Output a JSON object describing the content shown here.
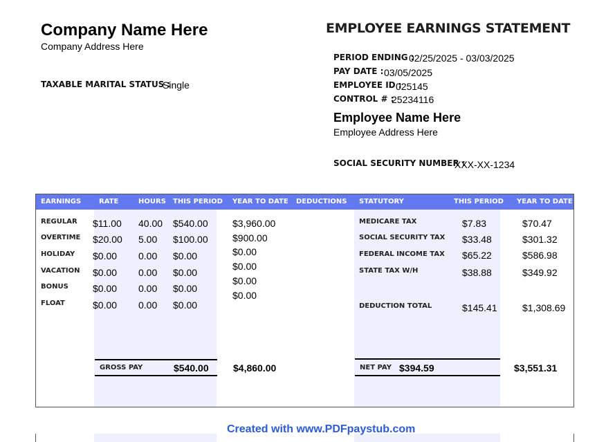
{
  "company": {
    "name": "Company Name Here",
    "address": "Company Address Here"
  },
  "title": "EMPLOYEE EARNINGS STATEMENT",
  "taxable_marital_status": {
    "label": "TAXABLE MARITAL STATUS :",
    "value": "Single"
  },
  "info": {
    "period_ending": {
      "label": "PERIOD ENDING :",
      "value": "02/25/2025 - 03/03/2025"
    },
    "pay_date": {
      "label": "PAY DATE :",
      "value": "03/05/2025"
    },
    "employee_id": {
      "label": "EMPLOYEE ID :",
      "value": "025145"
    },
    "control": {
      "label": "CONTROL # :",
      "value": "25234116"
    }
  },
  "employee": {
    "name": "Employee Name Here",
    "address": "Employee Address Here"
  },
  "ssn": {
    "label": "SOCIAL SECURITY NUMBER :",
    "value": "XXX-XX-1234"
  },
  "table_headers": {
    "earnings": "EARNINGS",
    "rate": "RATE",
    "hours": "HOURS",
    "this_period": "THIS PERIOD",
    "year_to_date": "YEAR TO DATE",
    "deductions": "DEDUCTIONS",
    "statutory": "STATUTORY",
    "this_period_2": "THIS PERIOD",
    "year_to_date_2": "YEAR TO DATE"
  },
  "earnings": [
    {
      "label": "REGULAR",
      "rate": "$11.00",
      "hours": "40.00",
      "this_period": "$540.00",
      "ytd": "$3,960.00"
    },
    {
      "label": "OVERTIME",
      "rate": "$20.00",
      "hours": "5.00",
      "this_period": "$100.00",
      "ytd": "$900.00"
    },
    {
      "label": "HOLIDAY",
      "rate": "$0.00",
      "hours": "0.00",
      "this_period": "$0.00",
      "ytd": "$0.00"
    },
    {
      "label": "VACATION",
      "rate": "$0.00",
      "hours": "0.00",
      "this_period": "$0.00",
      "ytd": "$0.00"
    },
    {
      "label": "BONUS",
      "rate": "$0.00",
      "hours": "0.00",
      "this_period": "$0.00",
      "ytd": "$0.00"
    },
    {
      "label": "FLOAT",
      "rate": "$0.00",
      "hours": "0.00",
      "this_period": "$0.00",
      "ytd": "$0.00"
    }
  ],
  "statutory": [
    {
      "label": "MEDICARE TAX",
      "this_period": "$7.83",
      "ytd": "$70.47"
    },
    {
      "label": "SOCIAL SECURITY TAX",
      "this_period": "$33.48",
      "ytd": "$301.32"
    },
    {
      "label": "FEDERAL INCOME TAX",
      "this_period": "$65.22",
      "ytd": "$586.98"
    },
    {
      "label": "STATE TAX W/H",
      "this_period": "$38.88",
      "ytd": "$349.92"
    }
  ],
  "deduction_total": {
    "label": "DEDUCTION TOTAL",
    "this_period": "$145.41",
    "ytd": "$1,308.69"
  },
  "gross_pay": {
    "label": "GROSS PAY",
    "this_period": "$540.00",
    "ytd": "$4,860.00"
  },
  "net_pay": {
    "label": "NET PAY",
    "this_period": "$394.59",
    "ytd": "$3,551.31"
  },
  "footer": "Created with www.PDFpaystub.com",
  "colors": {
    "header": "#6379ef",
    "shade": "#eef0fd",
    "footer": "#2d5bd6"
  }
}
